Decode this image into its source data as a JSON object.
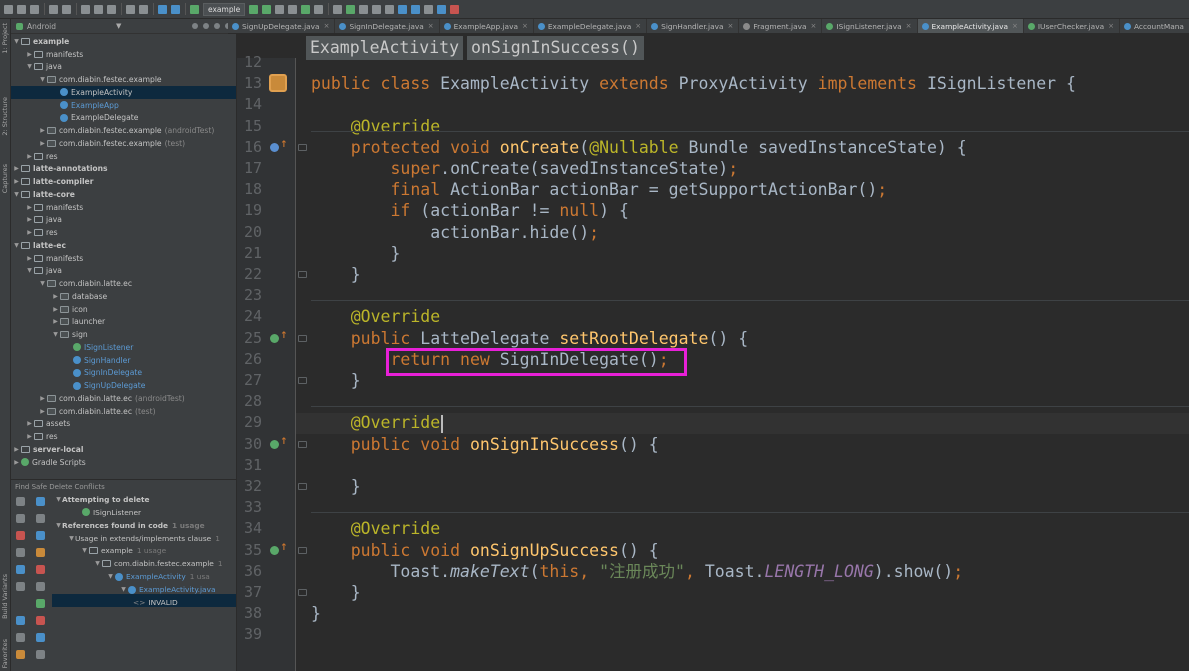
{
  "toolbar": {
    "module_select": "example",
    "run_config": "example"
  },
  "sidebar_tabs": [
    "1: Project",
    "2: Structure",
    "Captures",
    "Build Variants",
    "Favorites"
  ],
  "project": {
    "header": "Android",
    "tree": [
      {
        "label": "example",
        "indent": 0,
        "type": "module",
        "arrow": "▼",
        "bold": true
      },
      {
        "label": "manifests",
        "indent": 1,
        "type": "folder",
        "arrow": "▶"
      },
      {
        "label": "java",
        "indent": 1,
        "type": "folder",
        "arrow": "▼"
      },
      {
        "label": "com.diabin.festec.example",
        "indent": 2,
        "type": "package",
        "arrow": "▼"
      },
      {
        "label": "ExampleActivity",
        "indent": 3,
        "type": "class",
        "selected": true
      },
      {
        "label": "ExampleApp",
        "indent": 3,
        "type": "class",
        "blue": true
      },
      {
        "label": "ExampleDelegate",
        "indent": 3,
        "type": "class"
      },
      {
        "label": "com.diabin.festec.example",
        "suffix": "(androidTest)",
        "indent": 2,
        "type": "package",
        "arrow": "▶"
      },
      {
        "label": "com.diabin.festec.example",
        "suffix": "(test)",
        "indent": 2,
        "type": "package",
        "arrow": "▶"
      },
      {
        "label": "res",
        "indent": 1,
        "type": "folder",
        "arrow": "▶"
      },
      {
        "label": "latte-annotations",
        "indent": 0,
        "type": "module",
        "arrow": "▶",
        "bold": true
      },
      {
        "label": "latte-compiler",
        "indent": 0,
        "type": "module",
        "arrow": "▶",
        "bold": true
      },
      {
        "label": "latte-core",
        "indent": 0,
        "type": "module",
        "arrow": "▼",
        "bold": true
      },
      {
        "label": "manifests",
        "indent": 1,
        "type": "folder",
        "arrow": "▶"
      },
      {
        "label": "java",
        "indent": 1,
        "type": "folder",
        "arrow": "▶"
      },
      {
        "label": "res",
        "indent": 1,
        "type": "folder",
        "arrow": "▶"
      },
      {
        "label": "latte-ec",
        "indent": 0,
        "type": "module",
        "arrow": "▼",
        "bold": true
      },
      {
        "label": "manifests",
        "indent": 1,
        "type": "folder",
        "arrow": "▶"
      },
      {
        "label": "java",
        "indent": 1,
        "type": "folder",
        "arrow": "▼"
      },
      {
        "label": "com.diabin.latte.ec",
        "indent": 2,
        "type": "package",
        "arrow": "▼"
      },
      {
        "label": "database",
        "indent": 3,
        "type": "package",
        "arrow": "▶"
      },
      {
        "label": "icon",
        "indent": 3,
        "type": "package",
        "arrow": "▶"
      },
      {
        "label": "launcher",
        "indent": 3,
        "type": "package",
        "arrow": "▶"
      },
      {
        "label": "sign",
        "indent": 3,
        "type": "package",
        "arrow": "▼"
      },
      {
        "label": "ISignListener",
        "indent": 4,
        "type": "interface",
        "blue": true
      },
      {
        "label": "SignHandler",
        "indent": 4,
        "type": "class",
        "blue": true
      },
      {
        "label": "SignInDelegate",
        "indent": 4,
        "type": "class",
        "blue": true
      },
      {
        "label": "SignUpDelegate",
        "indent": 4,
        "type": "class",
        "blue": true
      },
      {
        "label": "com.diabin.latte.ec",
        "suffix": "(androidTest)",
        "indent": 2,
        "type": "package",
        "arrow": "▶"
      },
      {
        "label": "com.diabin.latte.ec",
        "suffix": "(test)",
        "indent": 2,
        "type": "package",
        "arrow": "▶"
      },
      {
        "label": "assets",
        "indent": 1,
        "type": "folder",
        "arrow": "▶"
      },
      {
        "label": "res",
        "indent": 1,
        "type": "folder",
        "arrow": "▶"
      },
      {
        "label": "server-local",
        "indent": 0,
        "type": "module",
        "arrow": "▶",
        "bold": true
      },
      {
        "label": "Gradle Scripts",
        "indent": 0,
        "type": "gradle",
        "arrow": "▶"
      }
    ]
  },
  "find": {
    "header": "Find Safe Delete Conflicts",
    "rows": [
      {
        "label": "Attempting to delete",
        "indent": 0,
        "arrow": "▼",
        "bold": true
      },
      {
        "label": "ISignListener",
        "indent": 2,
        "icon": "interface"
      },
      {
        "label": "References found in code",
        "count": "1 usage",
        "indent": 0,
        "arrow": "▼",
        "bold": true
      },
      {
        "label": "Usage in extends/implements clause",
        "count": "1",
        "indent": 1,
        "arrow": "▼"
      },
      {
        "label": "example",
        "count": "1 usage",
        "indent": 2,
        "arrow": "▼",
        "icon": "folder"
      },
      {
        "label": "com.diabin.festec.example",
        "count": "1",
        "indent": 3,
        "arrow": "▼",
        "icon": "folder"
      },
      {
        "label": "ExampleActivity",
        "count": "1 usa",
        "indent": 4,
        "arrow": "▼",
        "icon": "class",
        "blue": true
      },
      {
        "label": "ExampleActivity.java",
        "indent": 5,
        "arrow": "▼",
        "icon": "class",
        "blue": true
      },
      {
        "label": "INVALID",
        "indent": 6,
        "prefix": "<>"
      }
    ]
  },
  "tabs": [
    {
      "label": "SignUpDelegate.java",
      "icon": "class"
    },
    {
      "label": "SignInDelegate.java",
      "icon": "class"
    },
    {
      "label": "ExampleApp.java",
      "icon": "class"
    },
    {
      "label": "ExampleDelegate.java",
      "icon": "class"
    },
    {
      "label": "SignHandler.java",
      "icon": "class"
    },
    {
      "label": "Fragment.java",
      "icon": "frag"
    },
    {
      "label": "ISignListener.java",
      "icon": "interface"
    },
    {
      "label": "ExampleActivity.java",
      "icon": "class",
      "active": true
    },
    {
      "label": "IUserChecker.java",
      "icon": "interface"
    },
    {
      "label": "AccountMana",
      "icon": "class",
      "noclose": true
    }
  ],
  "breadcrumbs": [
    "ExampleActivity",
    "onSignInSuccess()"
  ],
  "code": {
    "line_numbers": [
      "12",
      "13",
      "14",
      "15",
      "16",
      "17",
      "18",
      "19",
      "20",
      "21",
      "22",
      "23",
      "24",
      "25",
      "26",
      "27",
      "28",
      "29",
      "30",
      "31",
      "32",
      "33",
      "34",
      "35",
      "36",
      "37",
      "38",
      "39"
    ],
    "lines": [
      [],
      [
        [
          "kw",
          "public class "
        ],
        [
          "",
          "ExampleActivity "
        ],
        [
          "kw",
          "extends "
        ],
        [
          "",
          "ProxyActivity "
        ],
        [
          "kw",
          "implements "
        ],
        [
          "",
          "ISignListener {"
        ]
      ],
      [],
      [
        [
          "",
          "    "
        ],
        [
          "an",
          "@Override"
        ]
      ],
      [
        [
          "",
          "    "
        ],
        [
          "kw",
          "protected void "
        ],
        [
          "fn",
          "onCreate"
        ],
        [
          "",
          "("
        ],
        [
          "an",
          "@Nullable "
        ],
        [
          "",
          "Bundle savedInstanceState) {"
        ]
      ],
      [
        [
          "",
          "        "
        ],
        [
          "kw",
          "super"
        ],
        [
          "",
          ".onCreate(savedInstanceState)"
        ],
        [
          "kw",
          ";"
        ]
      ],
      [
        [
          "",
          "        "
        ],
        [
          "kw",
          "final "
        ],
        [
          "",
          "ActionBar actionBar = getSupportActionBar()"
        ],
        [
          "kw",
          ";"
        ]
      ],
      [
        [
          "",
          "        "
        ],
        [
          "kw",
          "if "
        ],
        [
          "",
          "(actionBar != "
        ],
        [
          "kw",
          "null"
        ],
        [
          "",
          ") {"
        ]
      ],
      [
        [
          "",
          "            actionBar.hide()"
        ],
        [
          "kw",
          ";"
        ]
      ],
      [
        [
          "",
          "        }"
        ]
      ],
      [
        [
          "",
          "    }"
        ]
      ],
      [],
      [
        [
          "",
          "    "
        ],
        [
          "an",
          "@Override"
        ]
      ],
      [
        [
          "",
          "    "
        ],
        [
          "kw",
          "public "
        ],
        [
          "",
          "LatteDelegate "
        ],
        [
          "fn",
          "setRootDelegate"
        ],
        [
          "",
          "() {"
        ]
      ],
      [
        [
          "",
          "        "
        ],
        [
          "kw",
          "return new "
        ],
        [
          "",
          "SignInDelegate()"
        ],
        [
          "kw",
          ";"
        ]
      ],
      [
        [
          "",
          "    }"
        ]
      ],
      [],
      [
        [
          "",
          "    "
        ],
        [
          "an",
          "@Override"
        ]
      ],
      [
        [
          "",
          "    "
        ],
        [
          "kw",
          "public void "
        ],
        [
          "fn",
          "onSignInSuccess"
        ],
        [
          "",
          "() {"
        ]
      ],
      [],
      [
        [
          "",
          "    }"
        ]
      ],
      [],
      [
        [
          "",
          "    "
        ],
        [
          "an",
          "@Override"
        ]
      ],
      [
        [
          "",
          "    "
        ],
        [
          "kw",
          "public void "
        ],
        [
          "fn",
          "onSignUpSuccess"
        ],
        [
          "",
          "() {"
        ]
      ],
      [
        [
          "",
          "        Toast."
        ],
        [
          "it",
          "makeText"
        ],
        [
          "",
          "("
        ],
        [
          "kw",
          "this"
        ],
        [
          "kw",
          ", "
        ],
        [
          "st",
          "\"注册成功\""
        ],
        [
          "kw",
          ", "
        ],
        [
          "",
          "Toast."
        ],
        [
          "pf",
          "LENGTH_LONG"
        ],
        [
          "",
          ").show()"
        ],
        [
          "kw",
          ";"
        ]
      ],
      [
        [
          "",
          "    }"
        ]
      ],
      [
        [
          "",
          "}"
        ]
      ],
      []
    ]
  },
  "colors": {
    "highlight_box": "#e820d8",
    "keyword": "#cc7832",
    "annotation": "#bbb529",
    "method": "#ffc66d",
    "string": "#6a8759"
  }
}
